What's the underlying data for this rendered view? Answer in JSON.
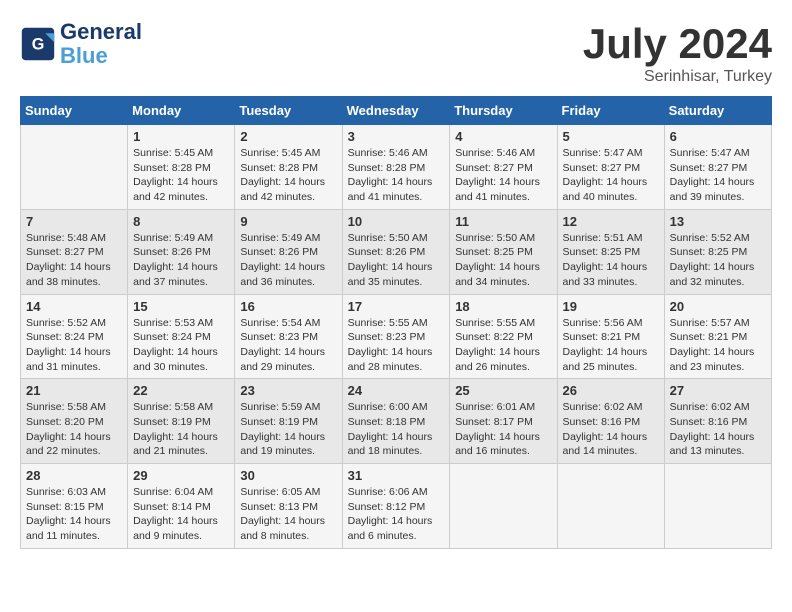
{
  "header": {
    "logo_line1": "General",
    "logo_line2": "Blue",
    "month": "July 2024",
    "location": "Serinhisar, Turkey"
  },
  "weekdays": [
    "Sunday",
    "Monday",
    "Tuesday",
    "Wednesday",
    "Thursday",
    "Friday",
    "Saturday"
  ],
  "weeks": [
    [
      {
        "day": "",
        "sunrise": "",
        "sunset": "",
        "daylight": ""
      },
      {
        "day": "1",
        "sunrise": "Sunrise: 5:45 AM",
        "sunset": "Sunset: 8:28 PM",
        "daylight": "Daylight: 14 hours and 42 minutes."
      },
      {
        "day": "2",
        "sunrise": "Sunrise: 5:45 AM",
        "sunset": "Sunset: 8:28 PM",
        "daylight": "Daylight: 14 hours and 42 minutes."
      },
      {
        "day": "3",
        "sunrise": "Sunrise: 5:46 AM",
        "sunset": "Sunset: 8:28 PM",
        "daylight": "Daylight: 14 hours and 41 minutes."
      },
      {
        "day": "4",
        "sunrise": "Sunrise: 5:46 AM",
        "sunset": "Sunset: 8:27 PM",
        "daylight": "Daylight: 14 hours and 41 minutes."
      },
      {
        "day": "5",
        "sunrise": "Sunrise: 5:47 AM",
        "sunset": "Sunset: 8:27 PM",
        "daylight": "Daylight: 14 hours and 40 minutes."
      },
      {
        "day": "6",
        "sunrise": "Sunrise: 5:47 AM",
        "sunset": "Sunset: 8:27 PM",
        "daylight": "Daylight: 14 hours and 39 minutes."
      }
    ],
    [
      {
        "day": "7",
        "sunrise": "Sunrise: 5:48 AM",
        "sunset": "Sunset: 8:27 PM",
        "daylight": "Daylight: 14 hours and 38 minutes."
      },
      {
        "day": "8",
        "sunrise": "Sunrise: 5:49 AM",
        "sunset": "Sunset: 8:26 PM",
        "daylight": "Daylight: 14 hours and 37 minutes."
      },
      {
        "day": "9",
        "sunrise": "Sunrise: 5:49 AM",
        "sunset": "Sunset: 8:26 PM",
        "daylight": "Daylight: 14 hours and 36 minutes."
      },
      {
        "day": "10",
        "sunrise": "Sunrise: 5:50 AM",
        "sunset": "Sunset: 8:26 PM",
        "daylight": "Daylight: 14 hours and 35 minutes."
      },
      {
        "day": "11",
        "sunrise": "Sunrise: 5:50 AM",
        "sunset": "Sunset: 8:25 PM",
        "daylight": "Daylight: 14 hours and 34 minutes."
      },
      {
        "day": "12",
        "sunrise": "Sunrise: 5:51 AM",
        "sunset": "Sunset: 8:25 PM",
        "daylight": "Daylight: 14 hours and 33 minutes."
      },
      {
        "day": "13",
        "sunrise": "Sunrise: 5:52 AM",
        "sunset": "Sunset: 8:25 PM",
        "daylight": "Daylight: 14 hours and 32 minutes."
      }
    ],
    [
      {
        "day": "14",
        "sunrise": "Sunrise: 5:52 AM",
        "sunset": "Sunset: 8:24 PM",
        "daylight": "Daylight: 14 hours and 31 minutes."
      },
      {
        "day": "15",
        "sunrise": "Sunrise: 5:53 AM",
        "sunset": "Sunset: 8:24 PM",
        "daylight": "Daylight: 14 hours and 30 minutes."
      },
      {
        "day": "16",
        "sunrise": "Sunrise: 5:54 AM",
        "sunset": "Sunset: 8:23 PM",
        "daylight": "Daylight: 14 hours and 29 minutes."
      },
      {
        "day": "17",
        "sunrise": "Sunrise: 5:55 AM",
        "sunset": "Sunset: 8:23 PM",
        "daylight": "Daylight: 14 hours and 28 minutes."
      },
      {
        "day": "18",
        "sunrise": "Sunrise: 5:55 AM",
        "sunset": "Sunset: 8:22 PM",
        "daylight": "Daylight: 14 hours and 26 minutes."
      },
      {
        "day": "19",
        "sunrise": "Sunrise: 5:56 AM",
        "sunset": "Sunset: 8:21 PM",
        "daylight": "Daylight: 14 hours and 25 minutes."
      },
      {
        "day": "20",
        "sunrise": "Sunrise: 5:57 AM",
        "sunset": "Sunset: 8:21 PM",
        "daylight": "Daylight: 14 hours and 23 minutes."
      }
    ],
    [
      {
        "day": "21",
        "sunrise": "Sunrise: 5:58 AM",
        "sunset": "Sunset: 8:20 PM",
        "daylight": "Daylight: 14 hours and 22 minutes."
      },
      {
        "day": "22",
        "sunrise": "Sunrise: 5:58 AM",
        "sunset": "Sunset: 8:19 PM",
        "daylight": "Daylight: 14 hours and 21 minutes."
      },
      {
        "day": "23",
        "sunrise": "Sunrise: 5:59 AM",
        "sunset": "Sunset: 8:19 PM",
        "daylight": "Daylight: 14 hours and 19 minutes."
      },
      {
        "day": "24",
        "sunrise": "Sunrise: 6:00 AM",
        "sunset": "Sunset: 8:18 PM",
        "daylight": "Daylight: 14 hours and 18 minutes."
      },
      {
        "day": "25",
        "sunrise": "Sunrise: 6:01 AM",
        "sunset": "Sunset: 8:17 PM",
        "daylight": "Daylight: 14 hours and 16 minutes."
      },
      {
        "day": "26",
        "sunrise": "Sunrise: 6:02 AM",
        "sunset": "Sunset: 8:16 PM",
        "daylight": "Daylight: 14 hours and 14 minutes."
      },
      {
        "day": "27",
        "sunrise": "Sunrise: 6:02 AM",
        "sunset": "Sunset: 8:16 PM",
        "daylight": "Daylight: 14 hours and 13 minutes."
      }
    ],
    [
      {
        "day": "28",
        "sunrise": "Sunrise: 6:03 AM",
        "sunset": "Sunset: 8:15 PM",
        "daylight": "Daylight: 14 hours and 11 minutes."
      },
      {
        "day": "29",
        "sunrise": "Sunrise: 6:04 AM",
        "sunset": "Sunset: 8:14 PM",
        "daylight": "Daylight: 14 hours and 9 minutes."
      },
      {
        "day": "30",
        "sunrise": "Sunrise: 6:05 AM",
        "sunset": "Sunset: 8:13 PM",
        "daylight": "Daylight: 14 hours and 8 minutes."
      },
      {
        "day": "31",
        "sunrise": "Sunrise: 6:06 AM",
        "sunset": "Sunset: 8:12 PM",
        "daylight": "Daylight: 14 hours and 6 minutes."
      },
      {
        "day": "",
        "sunrise": "",
        "sunset": "",
        "daylight": ""
      },
      {
        "day": "",
        "sunrise": "",
        "sunset": "",
        "daylight": ""
      },
      {
        "day": "",
        "sunrise": "",
        "sunset": "",
        "daylight": ""
      }
    ]
  ]
}
